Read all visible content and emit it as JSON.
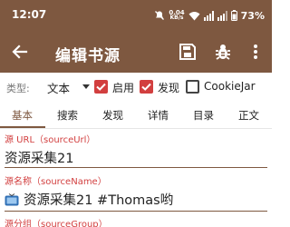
{
  "status_bar": {
    "time": "12:07",
    "net_speed_value": "0.04",
    "net_speed_unit": "KB/s",
    "battery": "73%"
  },
  "toolbar": {
    "title": "编辑书源",
    "back_icon": "arrow-back-icon",
    "save_icon": "save-icon",
    "debug_icon": "bug-icon",
    "more_icon": "more-vertical-icon"
  },
  "options": {
    "type_label": "类型:",
    "type_value": "文本",
    "enabled_label": "启用",
    "enabled_checked": true,
    "discover_label": "发现",
    "discover_checked": true,
    "cookiejar_label": "CookieJar",
    "cookiejar_checked": false
  },
  "tabs": [
    {
      "label": "基本",
      "active": true
    },
    {
      "label": "搜索",
      "active": false
    },
    {
      "label": "发现",
      "active": false
    },
    {
      "label": "详情",
      "active": false
    },
    {
      "label": "目录",
      "active": false
    },
    {
      "label": "正文",
      "active": false
    }
  ],
  "fields": [
    {
      "label": "源 URL（sourceUrl）",
      "value": "资源采集21"
    },
    {
      "label": "源名称（sourceName）",
      "value": "资源采集21 #Thomas哟"
    },
    {
      "label": "源分组（sourceGroup）",
      "value": ""
    }
  ],
  "colors": {
    "primary": "#7e5840",
    "accent": "#d23f3f"
  }
}
